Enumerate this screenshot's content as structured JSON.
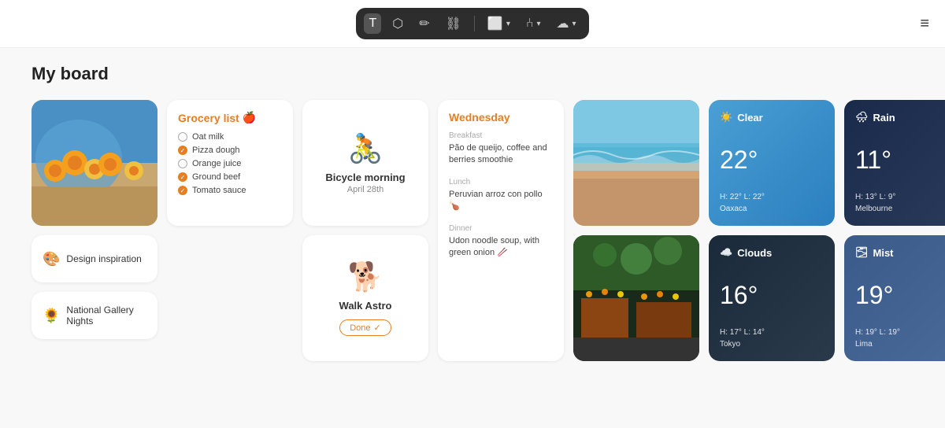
{
  "toolbar": {
    "buttons": [
      {
        "id": "text",
        "label": "T",
        "type": "text-tool"
      },
      {
        "id": "shape",
        "label": "⬡",
        "type": "shape-tool"
      },
      {
        "id": "pen",
        "label": "✏",
        "type": "pen-tool"
      },
      {
        "id": "link",
        "label": "🔗",
        "type": "link-tool"
      },
      {
        "id": "frame",
        "label": "⬜▾",
        "type": "frame-tool"
      },
      {
        "id": "connect",
        "label": "⑃▾",
        "type": "connect-tool"
      },
      {
        "id": "cloud",
        "label": "☁▾",
        "type": "cloud-tool"
      }
    ]
  },
  "board": {
    "title": "My board",
    "grocery": {
      "title": "Grocery list",
      "emoji": "🍎",
      "items": [
        {
          "label": "Oat milk",
          "checked": false
        },
        {
          "label": "Pizza dough",
          "checked": true
        },
        {
          "label": "Orange juice",
          "checked": false
        },
        {
          "label": "Ground beef",
          "checked": true
        },
        {
          "label": "Tomato sauce",
          "checked": true
        }
      ]
    },
    "bicycle": {
      "emoji": "🚴",
      "title": "Bicycle morning",
      "date": "April 28th"
    },
    "walkAstro": {
      "emoji": "🐕",
      "title": "Walk Astro",
      "badge": "Done",
      "badge_icon": "✓"
    },
    "wednesday": {
      "title": "Wednesday",
      "breakfast_label": "Breakfast",
      "breakfast_text": "Pão de queijo, coffee and berries smoothie",
      "lunch_label": "Lunch",
      "lunch_text": "Peruvian arroz con pollo 🍗",
      "dinner_label": "Dinner",
      "dinner_text": "Udon noodle soup, with green onion 🥢"
    },
    "design": {
      "emoji": "🎨",
      "title": "Design inspiration"
    },
    "gallery": {
      "emoji": "🌻",
      "title": "National Gallery Nights"
    },
    "weather": [
      {
        "condition": "Clear",
        "emoji": "☀️",
        "temp": "22°",
        "high": "22°",
        "low": "22°",
        "city": "Oaxaca",
        "style": "clear"
      },
      {
        "condition": "Rain",
        "emoji": "🌧",
        "temp": "11°",
        "high": "13°",
        "low": "9°",
        "city": "Melbourne",
        "style": "rain"
      },
      {
        "condition": "Clouds",
        "emoji": "☁️",
        "temp": "16°",
        "high": "17°",
        "low": "14°",
        "city": "Tokyo",
        "style": "clouds"
      },
      {
        "condition": "Mist",
        "emoji": "🌫",
        "temp": "19°",
        "high": "19°",
        "low": "19°",
        "city": "Lima",
        "style": "mist"
      }
    ]
  }
}
